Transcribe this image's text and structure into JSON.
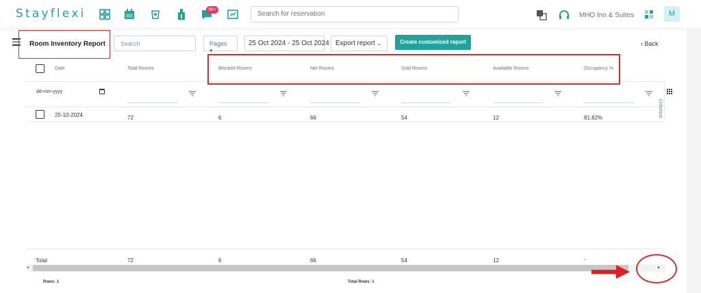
{
  "topbar": {
    "logo": "Stayflexi",
    "badge_count": "99+",
    "search_placeholder": "Search for reservation",
    "hotel_name": "MHO Inn & Suites",
    "avatar_initial": "M",
    "nav_icons": [
      "dashboard-icon",
      "calendar-icon",
      "housekeeping-icon",
      "pos-icon",
      "messages-icon",
      "reports-icon"
    ],
    "accent_color": "#1fa39a"
  },
  "toolbar": {
    "title": "Room Inventory Report",
    "search_placeholder": "Search",
    "pages_label": "Pages",
    "date_range": "25 Oct 2024 - 25 Oct 2024",
    "export_label": "Export report",
    "create_label": "Create customized report",
    "back_label": "Back"
  },
  "grid": {
    "columns": [
      "Date",
      "Total Rooms",
      "Blocked Rooms",
      "Net Rooms",
      "Sold Rooms",
      "Available Rooms",
      "Occupancy %"
    ],
    "date_filter_placeholder": "dd-mm-yyyy",
    "rows": [
      {
        "date": "25-10-2024",
        "total": "72",
        "blocked": "6",
        "net": "66",
        "sold": "54",
        "available": "12",
        "occupancy": "81.82%"
      }
    ],
    "total_row": {
      "label": "Total",
      "total": "72",
      "blocked": "6",
      "net": "66",
      "sold": "54",
      "available": "12",
      "occupancy": "-"
    },
    "columns_panel_label": "Columns"
  },
  "status": {
    "rows_label": "Rows: 1",
    "total_rows_label": "Total Rows: 1"
  }
}
